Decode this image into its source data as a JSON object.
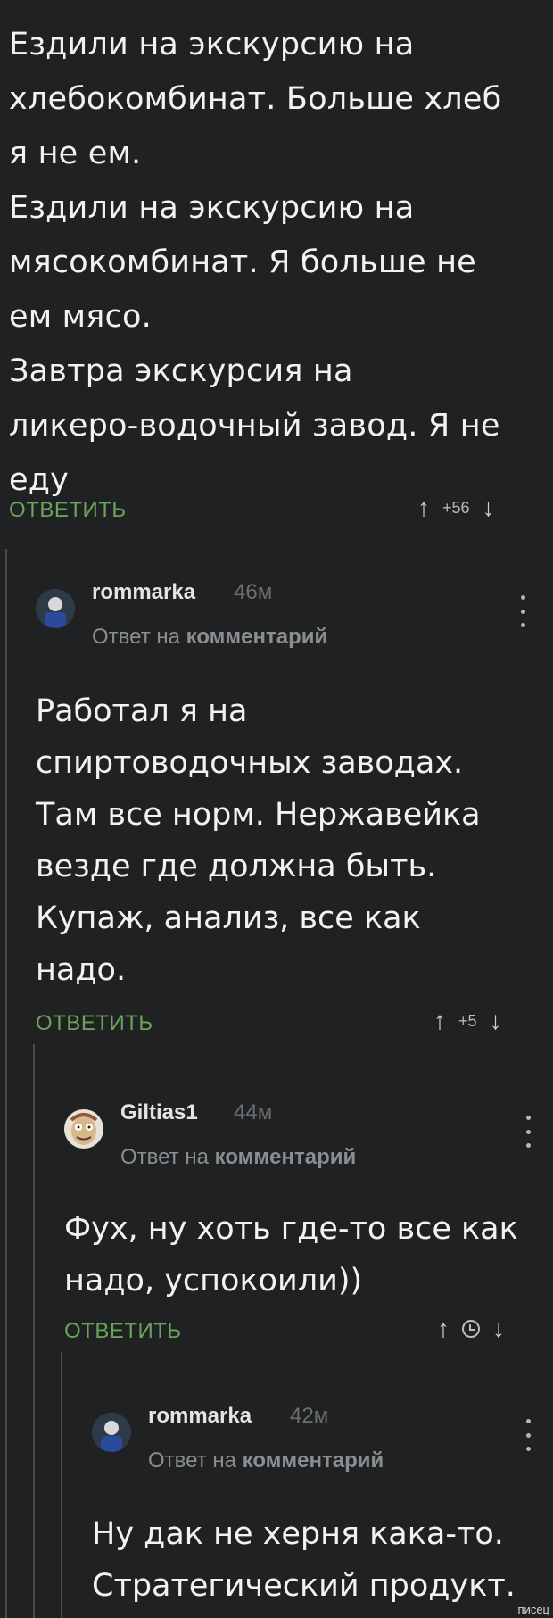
{
  "top_comment": {
    "lines": [
      "Ездили на экскурсию на",
      "хлебокомбинат. Больше хлеб",
      "я не ем.",
      "Ездили на экскурсию на",
      "мясокомбинат. Я больше не",
      "ем мясо.",
      "Завтра экскурсия на",
      "ликеро-водочный завод. Я не",
      "еду"
    ],
    "reply_label": "ОТВЕТИТЬ",
    "score": "+56"
  },
  "comments": [
    {
      "username": "rommarka",
      "time": "46м",
      "reply_prefix": "Ответ на",
      "reply_target": "комментарий",
      "lines": [
        "Работал я на",
        "спиртоводочных заводах.",
        "Там все норм. Нержавейка",
        "везде где должна быть.",
        "Купаж, анализ, все как",
        "надо."
      ],
      "reply_label": "ОТВЕТИТЬ",
      "score": "+5"
    },
    {
      "username": "Giltias1",
      "time": "44м",
      "reply_prefix": "Ответ на",
      "reply_target": "комментарий",
      "lines": [
        "Фух, ну хоть где-то все как",
        "надо, успокоили))"
      ],
      "reply_label": "ОТВЕТИТЬ",
      "score_icon": "timer-icon"
    },
    {
      "username": "rommarka",
      "time": "42м",
      "reply_prefix": "Ответ на",
      "reply_target": "комментарий",
      "lines": [
        "Ну дак не херня кака-то.",
        "Стратегический продукт."
      ]
    }
  ],
  "icons": {
    "upvote": "↑",
    "downvote": "↓"
  },
  "colors": {
    "background": "#1f2122",
    "reply_green": "#6aa35a",
    "muted": "#8b8e90"
  },
  "watermark": "писец"
}
